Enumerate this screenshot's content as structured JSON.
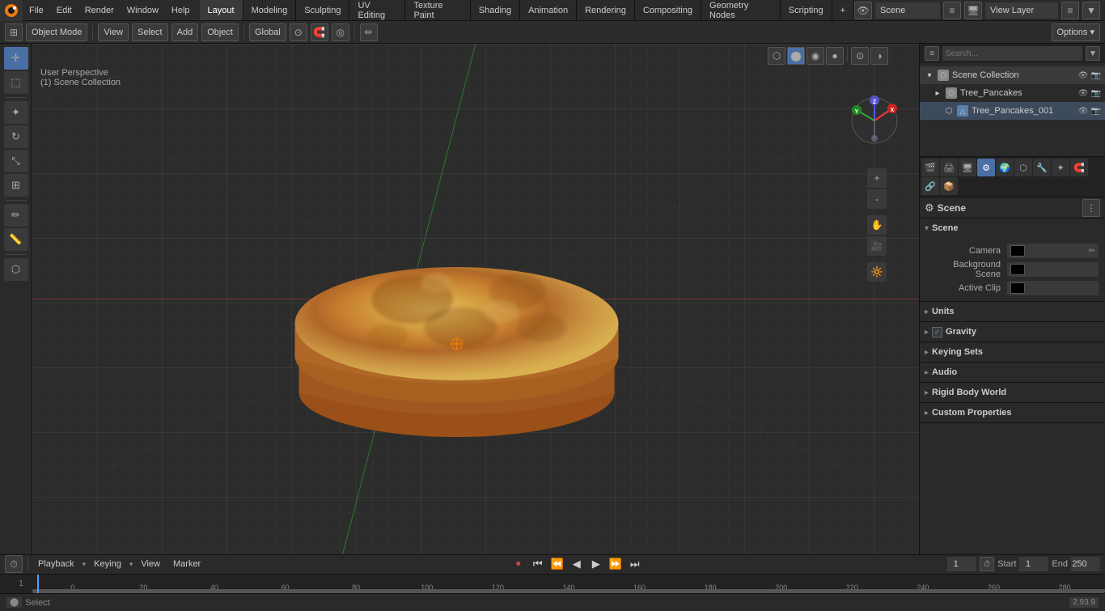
{
  "app": {
    "title": "Blender",
    "version": "2.93.9"
  },
  "menubar": {
    "items": [
      "File",
      "Edit",
      "Render",
      "Window",
      "Help"
    ]
  },
  "workspaces": {
    "tabs": [
      "Layout",
      "Modeling",
      "Sculpting",
      "UV Editing",
      "Texture Paint",
      "Shading",
      "Animation",
      "Rendering",
      "Compositing",
      "Geometry Nodes",
      "Scripting"
    ],
    "active": "Layout",
    "add_label": "+"
  },
  "top_right": {
    "scene": "Scene",
    "view_layer": "View Layer"
  },
  "viewport": {
    "header": {
      "mode": "Object Mode",
      "view_label": "View",
      "select_label": "Select",
      "add_label": "Add",
      "object_label": "Object",
      "global_label": "Global",
      "options_label": "Options ▾"
    },
    "info": {
      "perspective": "User Perspective",
      "collection": "(1) Scene Collection"
    }
  },
  "outliner": {
    "title": "Scene Collection",
    "items": [
      {
        "label": "Tree_Pancakes",
        "icon": "▸",
        "indent": 0,
        "expanded": false
      },
      {
        "label": "Tree_Pancakes_001",
        "icon": "⬡",
        "indent": 1
      }
    ]
  },
  "properties": {
    "active_tab": "scene",
    "tabs": [
      "🎬",
      "📷",
      "🖥",
      "⚙",
      "✦",
      "🌍",
      "🧲",
      "💡",
      "📦",
      "⬡",
      "🔵"
    ],
    "scene_label": "Scene",
    "sections": {
      "scene": {
        "title": "Scene",
        "subsections": [
          {
            "title": "Camera",
            "type": "prop",
            "value": ""
          },
          {
            "title": "Background Scene",
            "type": "prop",
            "value": ""
          },
          {
            "title": "Active Clip",
            "type": "prop",
            "value": ""
          }
        ]
      },
      "units": {
        "title": "Units"
      },
      "gravity": {
        "title": "Gravity",
        "enabled": true
      },
      "keying_sets": {
        "title": "Keying Sets"
      },
      "audio": {
        "title": "Audio"
      },
      "rigid_body_world": {
        "title": "Rigid Body World"
      },
      "custom_properties": {
        "title": "Custom Properties"
      }
    }
  },
  "timeline": {
    "playback_label": "Playback",
    "keying_label": "Keying",
    "view_label": "View",
    "marker_label": "Marker",
    "current_frame": "1",
    "start_frame": "1",
    "end_frame": "250",
    "start_label": "Start",
    "end_label": "End",
    "ruler_marks": [
      "0",
      "40",
      "80",
      "120",
      "160",
      "200",
      "240"
    ],
    "ruler_marks_full": [
      "0",
      "20",
      "40",
      "60",
      "80",
      "100",
      "120",
      "140",
      "160",
      "180",
      "200",
      "220",
      "240",
      "260",
      "280"
    ]
  },
  "status_bar": {
    "select_label": "Select",
    "version": "2.93.9"
  },
  "colors": {
    "active_blue": "#4a6fa5",
    "axis_red": "#cc2222",
    "axis_green": "#22cc44"
  }
}
